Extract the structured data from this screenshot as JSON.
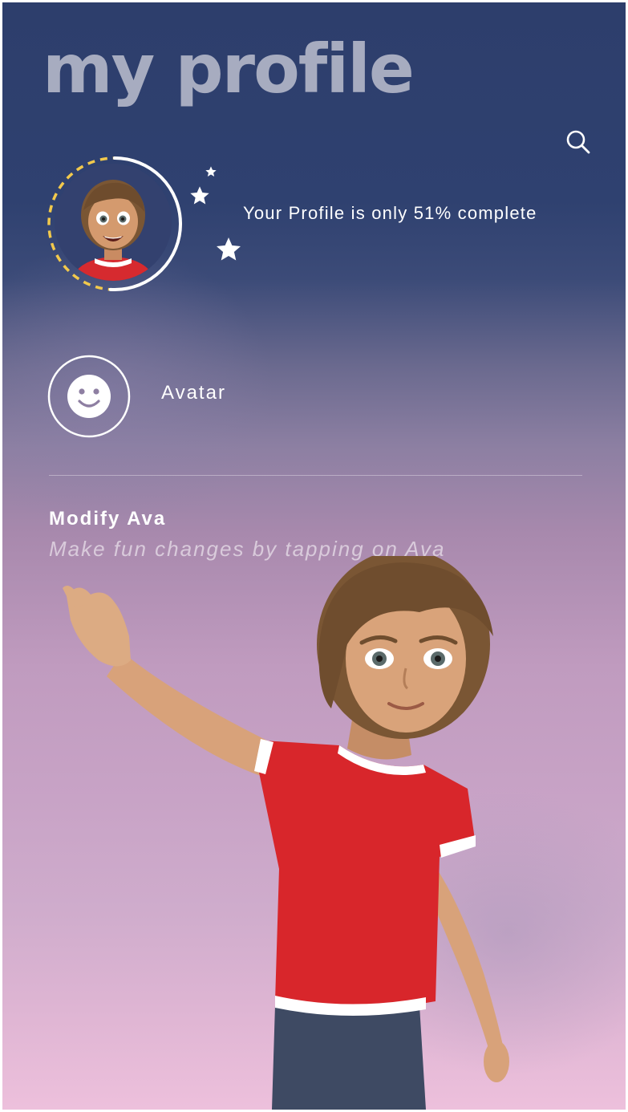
{
  "header": {
    "title": "my profile",
    "search_icon": "search-icon"
  },
  "profile": {
    "avatar_icon": "avatar-thumbnail",
    "progress_text": "Your Profile is only 51% complete",
    "progress_fraction": 0.51,
    "ring_color": "#ffffff",
    "ring_remaining_color": "#f2c94c",
    "decorations": [
      "star-icon",
      "star-icon",
      "star-icon"
    ]
  },
  "menu": {
    "avatar": {
      "icon": "smiley-icon",
      "label": "Avatar"
    }
  },
  "modify": {
    "title": "Modify Ava",
    "subtitle": "Make fun changes by tapping on Ava",
    "character": "ava-character"
  },
  "colors": {
    "background_top": "#2d3e6c",
    "background_bottom": "#edc0dc",
    "title_color": "#a7acc0",
    "shirt": "#d8262b"
  }
}
